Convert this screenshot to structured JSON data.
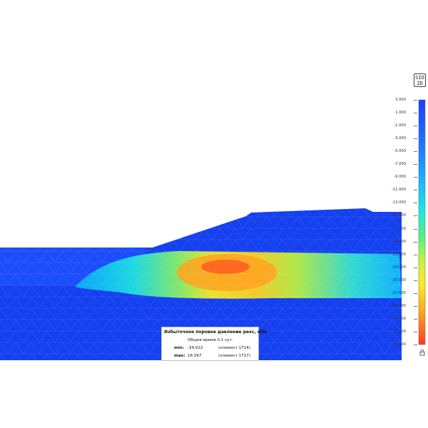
{
  "logo": {
    "line1": "SIO",
    "line2": "2D"
  },
  "legend": {
    "title": "Избыточное поровое давление pexc, кПа",
    "subtitle": "Общее время 0.1 сут.",
    "min_label": "min:",
    "min_value": "-34.022",
    "min_element": "(элемент 1714)",
    "max_label": "max:",
    "max_value": "16.567",
    "max_element": "(элемент 1717)"
  },
  "scale": {
    "ticks": [
      "3.000",
      "1.000",
      "-1.000",
      "-3.000",
      "-5.000",
      "-7.000",
      "-9.000",
      "-11.000",
      "-13.000",
      "-15.000",
      "-17.000",
      "-19.000",
      "-21.000",
      "-23.000",
      "-25.000",
      "-27.000",
      "-29.000",
      "-31.000",
      "-33.000",
      "-35.000"
    ],
    "colors": [
      "#1f3cff",
      "#1f7bff",
      "#17b6ff",
      "#19e6e0",
      "#4cf08a",
      "#c9f23a",
      "#ffe81f",
      "#ff9b1f",
      "#ff4b1f"
    ]
  },
  "icons": {
    "lock": "lock-icon"
  }
}
